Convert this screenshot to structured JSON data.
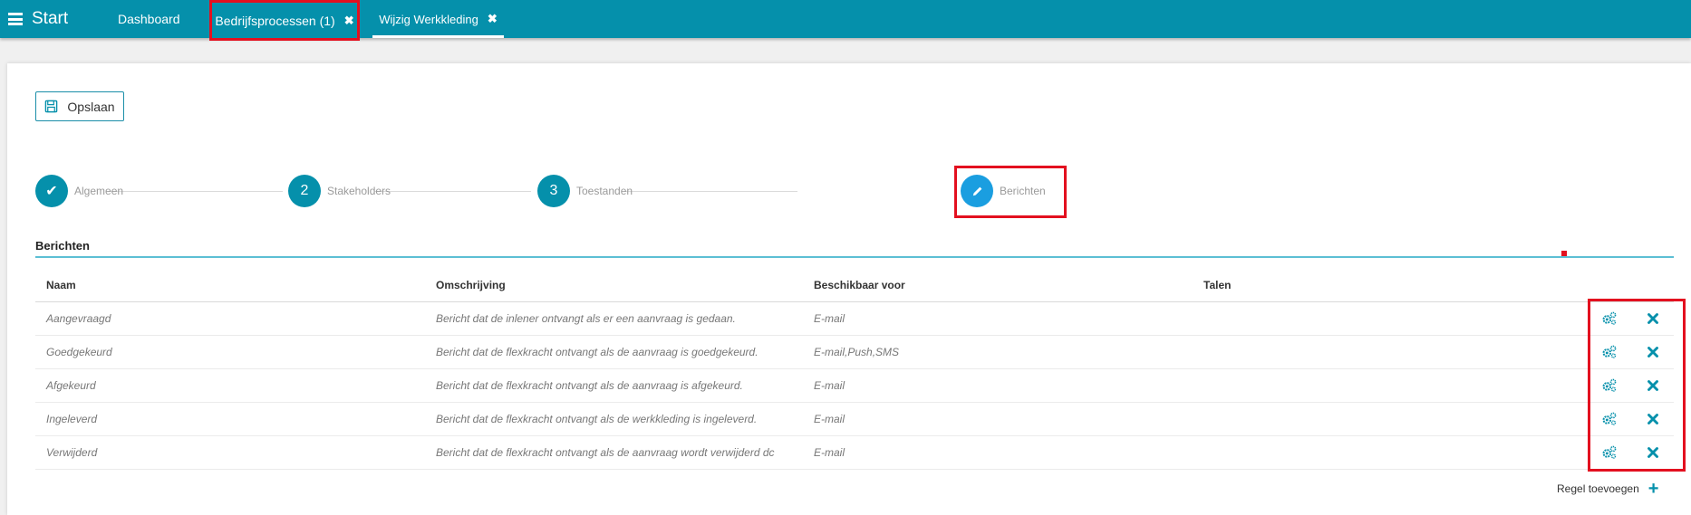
{
  "topbar": {
    "start_label": "Start",
    "tabs": [
      {
        "label": "Dashboard"
      },
      {
        "label": "Bedrijfsprocessen (1)",
        "close": "✖"
      },
      {
        "label": "Wijzig Werkkleding",
        "close": "✖"
      }
    ]
  },
  "toolbar": {
    "save_label": "Opslaan"
  },
  "steps": [
    {
      "marker": "✔",
      "label": "Algemeen"
    },
    {
      "marker": "2",
      "label": "Stakeholders"
    },
    {
      "marker": "3",
      "label": "Toestanden"
    },
    {
      "marker": "pencil-icon",
      "label": "Berichten"
    }
  ],
  "section": {
    "title": "Berichten"
  },
  "table": {
    "columns": [
      "Naam",
      "Omschrijving",
      "Beschikbaar voor",
      "Talen"
    ],
    "rows": [
      {
        "naam": "Aangevraagd",
        "omschrijving": "Bericht dat de inlener ontvangt als er een aanvraag is gedaan.",
        "beschikbaar": "E-mail",
        "talen": ""
      },
      {
        "naam": "Goedgekeurd",
        "omschrijving": "Bericht dat de flexkracht ontvangt als de aanvraag is goedgekeurd.",
        "beschikbaar": "E-mail,Push,SMS",
        "talen": ""
      },
      {
        "naam": "Afgekeurd",
        "omschrijving": "Bericht dat de flexkracht ontvangt als de aanvraag is afgekeurd.",
        "beschikbaar": "E-mail",
        "talen": ""
      },
      {
        "naam": "Ingeleverd",
        "omschrijving": "Bericht dat de flexkracht ontvangt als de werkkleding is ingeleverd.",
        "beschikbaar": "E-mail",
        "talen": ""
      },
      {
        "naam": "Verwijderd",
        "omschrijving": "Bericht dat de flexkracht ontvangt als de aanvraag wordt verwijderd dc",
        "beschikbaar": "E-mail",
        "talen": ""
      }
    ]
  },
  "add_row": {
    "label": "Regel toevoegen"
  },
  "colors": {
    "brand": "#0590ab",
    "highlight": "#e3101f",
    "active_step": "#1a9ee0"
  }
}
